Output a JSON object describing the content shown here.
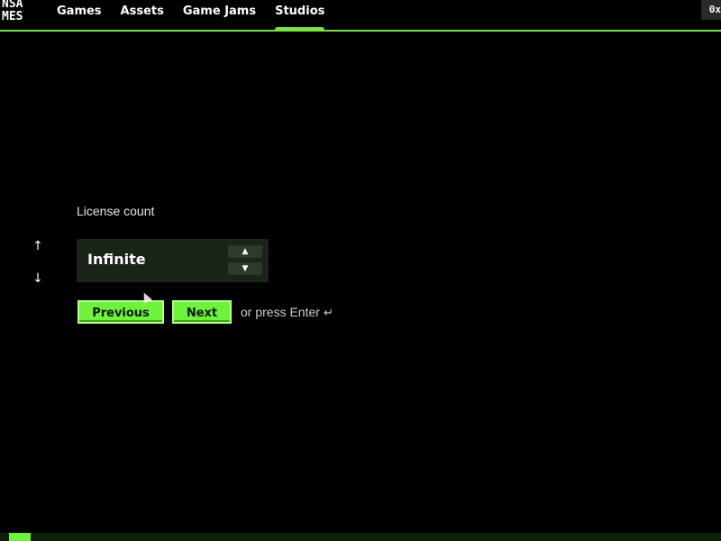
{
  "logo": {
    "line1": "NSA",
    "line2": "MES"
  },
  "nav": {
    "items": [
      {
        "label": "Games"
      },
      {
        "label": "Assets"
      },
      {
        "label": "Game Jams"
      },
      {
        "label": "Studios"
      }
    ],
    "active_index": 3
  },
  "corner_label": "0x",
  "side_arrows": {
    "up_icon": "↑",
    "down_icon": "↓"
  },
  "form": {
    "label": "License count",
    "value": "Infinite",
    "stepper_up_icon": "▲",
    "stepper_down_icon": "▼",
    "prev_label": "Previous",
    "next_label": "Next",
    "hint": "or press Enter",
    "enter_icon": "↵"
  },
  "progress": {
    "fraction": 0.03
  },
  "colors": {
    "accent": "#6ef23c",
    "nav_underline": "#7ce04a",
    "panel_bg": "#1a2418"
  }
}
